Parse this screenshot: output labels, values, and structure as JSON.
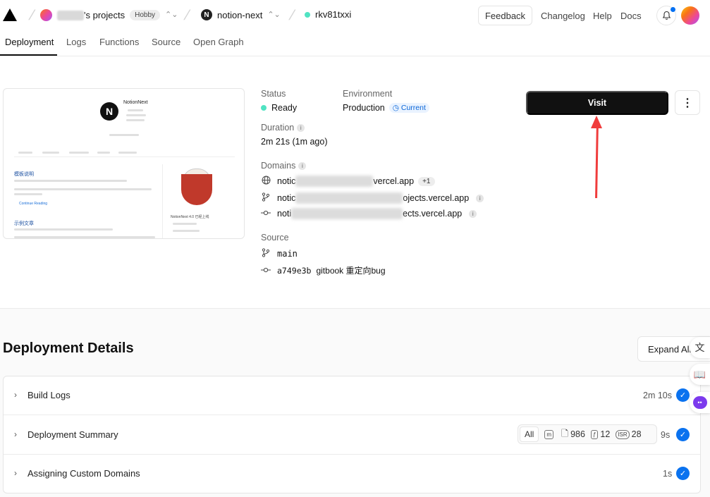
{
  "topbar": {
    "team_label": "'s projects",
    "plan_badge": "Hobby",
    "project_name": "notion-next",
    "deployment_id": "rkv81txxi",
    "feedback_label": "Feedback",
    "links": [
      "Changelog",
      "Help",
      "Docs"
    ]
  },
  "tabs": [
    {
      "label": "Deployment",
      "active": true
    },
    {
      "label": "Logs",
      "active": false
    },
    {
      "label": "Functions",
      "active": false
    },
    {
      "label": "Source",
      "active": false
    },
    {
      "label": "Open Graph",
      "active": false
    }
  ],
  "preview": {
    "site_title": "NotionNext",
    "post_1_title": "模板说明",
    "post_2_title": "示例文章",
    "sidebar_caption": "NotionNext 4.0 已经上线",
    "read_more": "Continue Reading"
  },
  "overview": {
    "status_label": "Status",
    "status_value": "Ready",
    "environment_label": "Environment",
    "environment_value": "Production",
    "current_badge": "Current",
    "duration_label": "Duration",
    "duration_value": "2m 21s (1m ago)",
    "domains_label": "Domains",
    "domains": [
      {
        "prefix": "notic",
        "suffix": "vercel.app",
        "extra_badge": "+1"
      },
      {
        "prefix": "notic",
        "suffix": "ojects.vercel.app",
        "extra_badge": ""
      },
      {
        "prefix": "noti",
        "suffix": "ects.vercel.app",
        "extra_badge": ""
      }
    ],
    "source_label": "Source",
    "branch": "main",
    "commit_hash": "a749e3b",
    "commit_message": "gitbook 重定向bug",
    "visit_label": "Visit",
    "more_label": "⋮"
  },
  "details": {
    "title": "Deployment Details",
    "expand_label": "Expand All",
    "rows": [
      {
        "title": "Build Logs",
        "time": "2m 10s"
      },
      {
        "title": "Deployment Summary",
        "time": "9s"
      },
      {
        "title": "Assigning Custom Domains",
        "time": "1s"
      }
    ],
    "summary": {
      "all_label": "All",
      "static_count": "986",
      "functions_count": "12",
      "isr_label": "ISR",
      "isr_count": "28"
    }
  },
  "colors": {
    "accent_blue": "#0a72ef",
    "ready_green": "#50e3c2",
    "annotation_red": "#f03c3c"
  }
}
